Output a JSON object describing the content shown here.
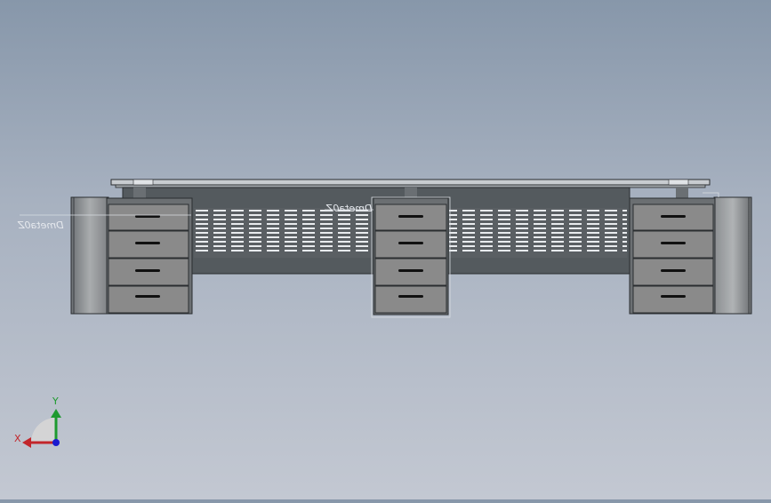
{
  "viewport": {
    "model": "desk assembly (front view)",
    "annotations": [
      "Dmeta0Z",
      "Dmeta0Z"
    ]
  },
  "triad": {
    "x_label": "X",
    "y_label": "Y"
  },
  "colors": {
    "background_top": "#8797aa",
    "background_bottom": "#c3c8d2",
    "panel_dark": "#545a5e",
    "drawer": "#8a8a8a",
    "edge": "#2a2d30",
    "axis_x": "#c2262b",
    "axis_y": "#1e9a2f",
    "axis_z": "#1a1ad0"
  }
}
